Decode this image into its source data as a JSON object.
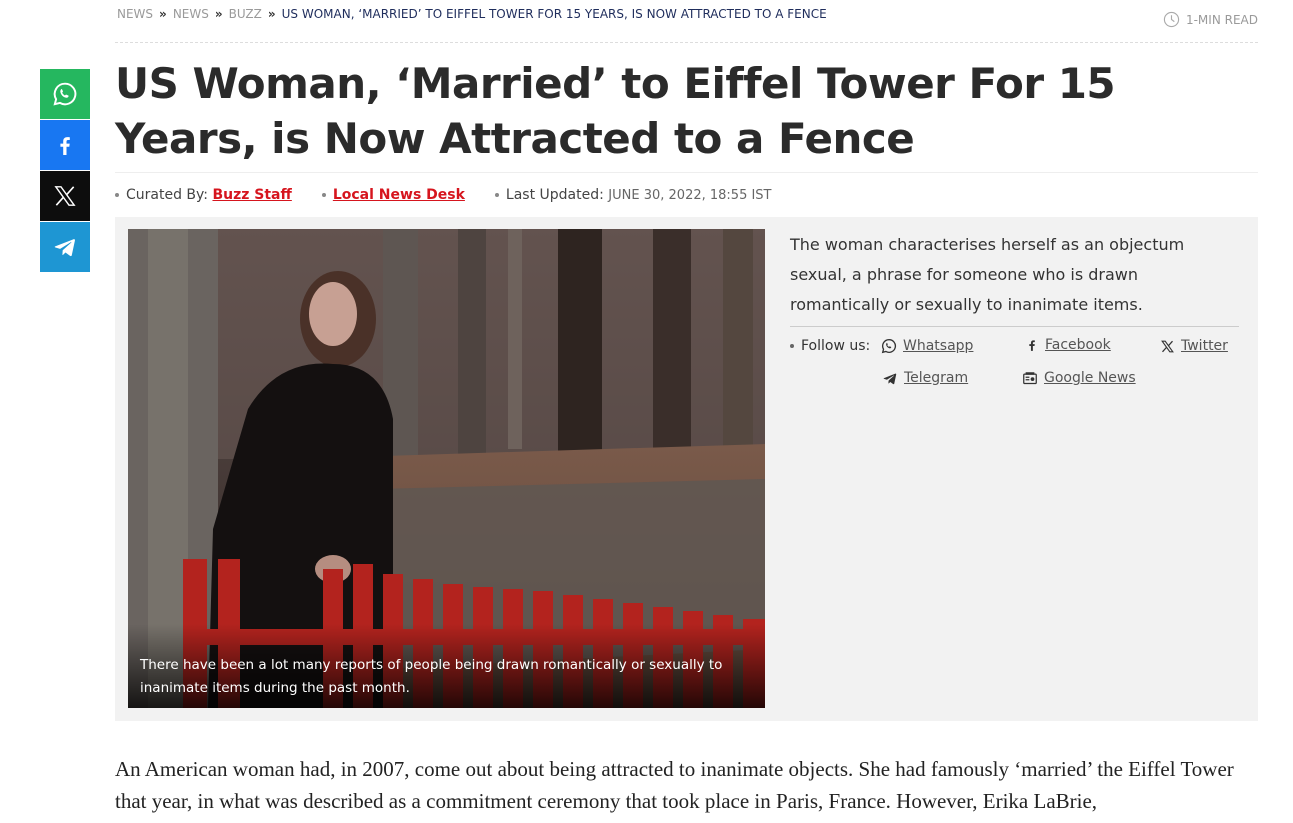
{
  "breadcrumb": {
    "items": [
      "NEWS",
      "NEWS",
      "BUZZ"
    ],
    "current": "US WOMAN, ‘MARRIED’ TO EIFFEL TOWER FOR 15 YEARS, IS NOW ATTRACTED TO A FENCE"
  },
  "read_time": "1-MIN READ",
  "headline": "US Woman, ‘Married’ to Eiffel Tower For 15 Years, is Now Attracted to a Fence",
  "byline": {
    "curated_label": "Curated By:",
    "curated_by": "Buzz Staff",
    "desk": "Local News Desk",
    "updated_label": "Last Updated:",
    "updated": "JUNE 30, 2022, 18:55 IST"
  },
  "share": [
    {
      "name": "whatsapp",
      "icon": "whatsapp-icon",
      "color": "#25b75f"
    },
    {
      "name": "facebook",
      "icon": "facebook-icon",
      "color": "#1877f2"
    },
    {
      "name": "x",
      "icon": "x-icon",
      "color": "#0d0d0d"
    },
    {
      "name": "telegram",
      "icon": "telegram-icon",
      "color": "#1e96d3"
    }
  ],
  "photo": {
    "caption": "There have been a lot many reports of people being drawn romantically or sexually to inanimate items during the past month."
  },
  "summary": "The woman characterises herself as an objectum sexual, a phrase for someone who is drawn romantically or sexually to inanimate items.",
  "follow": {
    "label": "Follow us:",
    "links": {
      "whatsapp": "Whatsapp",
      "facebook": "Facebook",
      "twitter": "Twitter",
      "telegram": "Telegram",
      "google_news": "Google News"
    }
  },
  "article": {
    "paragraph1": "An American woman had, in 2007, come out about being attracted to inanimate objects. She had famously ‘married’ the Eiffel Tower that year, in what was described as a commitment ceremony that took place in Paris, France. However, Erika LaBrie,"
  },
  "colors": {
    "accent_red": "#d6151e",
    "breadcrumb_current": "#1f2d5c"
  }
}
